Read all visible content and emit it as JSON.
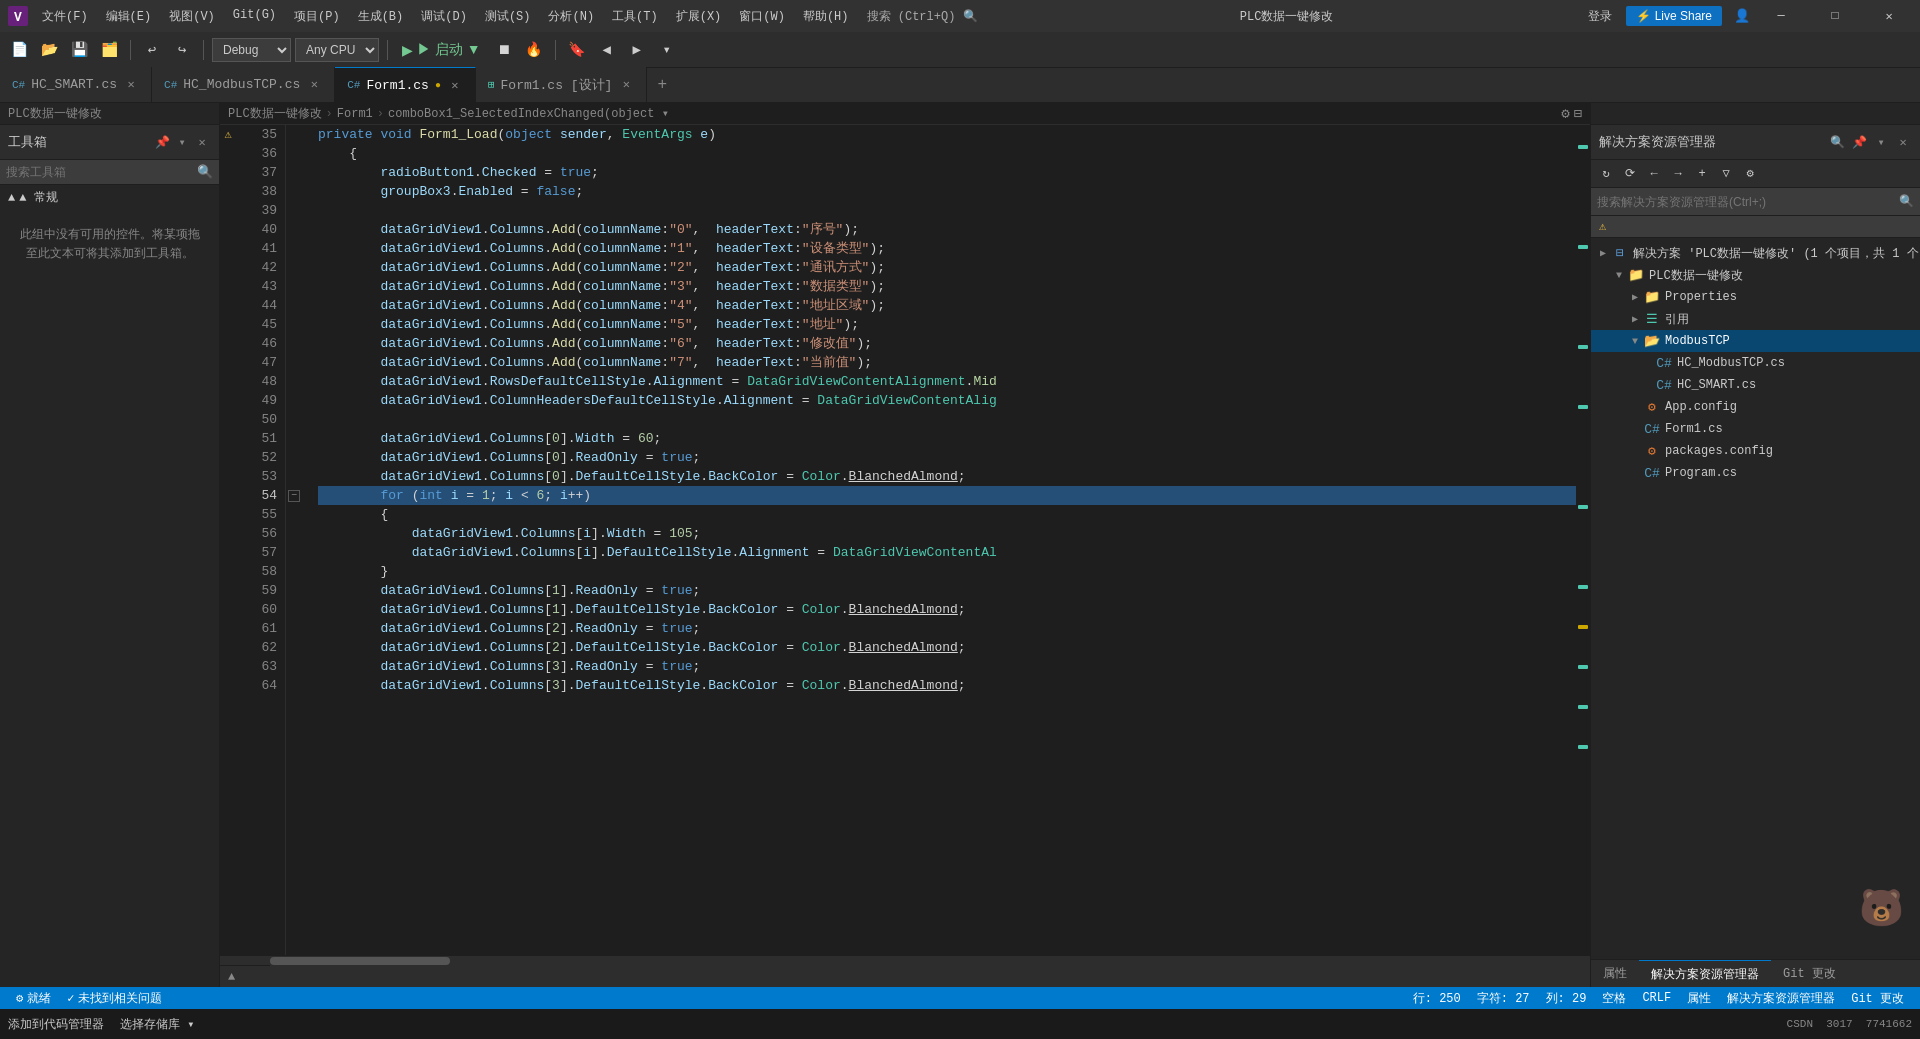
{
  "titleBar": {
    "title": "PLC数据一键修改",
    "menus": [
      "文件(F)",
      "编辑(E)",
      "视图(V)",
      "Git(G)",
      "项目(P)",
      "生成(B)",
      "调试(D)",
      "测试(S)",
      "分析(N)",
      "工具(T)",
      "扩展(X)",
      "窗口(W)",
      "帮助(H)",
      "搜索 (Ctrl+Q)"
    ],
    "loginLabel": "登录",
    "liveshare": "Live Share",
    "winBtns": [
      "—",
      "□",
      "✕"
    ]
  },
  "toolbar": {
    "debugMode": "Debug",
    "platform": "Any CPU",
    "runLabel": "▶ 启动 ▼",
    "buttons": [
      "↩",
      "↪",
      "⬛",
      "▷",
      "⏸",
      "🔥",
      "📁",
      "📋",
      "🔒",
      "📑",
      "◀",
      "▶",
      "▶▶",
      "▶|"
    ]
  },
  "tabs": [
    {
      "label": "HC_SMART.cs",
      "active": false,
      "modified": false
    },
    {
      "label": "HC_ModbusTCP.cs",
      "active": false,
      "modified": false
    },
    {
      "label": "Form1.cs",
      "active": true,
      "modified": true
    },
    {
      "label": "Form1.cs [设计]",
      "active": false,
      "modified": false
    }
  ],
  "breadcrumb": {
    "items": [
      "PLC数据一键修改",
      "Form1",
      "comboBox1_SelectedIndexChanged(object ▾"
    ]
  },
  "toolbox": {
    "title": "工具箱",
    "searchPlaceholder": "搜索工具箱",
    "category": "▲ 常规",
    "emptyText": "此组中没有可用的控件。将某项拖至此文本可将其添加到工具箱。"
  },
  "codeLines": [
    {
      "num": 35,
      "content": "private void Form1_Load(object sender, EventArgs e)",
      "hasCollapse": false
    },
    {
      "num": 36,
      "content": "    {",
      "hasCollapse": false
    },
    {
      "num": 37,
      "content": "        radioButton1.Checked = true;",
      "hasCollapse": false
    },
    {
      "num": 38,
      "content": "        groupBox3.Enabled = false;",
      "hasCollapse": false
    },
    {
      "num": 39,
      "content": "",
      "hasCollapse": false
    },
    {
      "num": 40,
      "content": "        dataGridView1.Columns.Add(columnName:\"0\",  headerText:\"序号\");",
      "hasCollapse": false
    },
    {
      "num": 41,
      "content": "        dataGridView1.Columns.Add(columnName:\"1\",  headerText:\"设备类型\");",
      "hasCollapse": false
    },
    {
      "num": 42,
      "content": "        dataGridView1.Columns.Add(columnName:\"2\",  headerText:\"通讯方式\");",
      "hasCollapse": false
    },
    {
      "num": 43,
      "content": "        dataGridView1.Columns.Add(columnName:\"3\",  headerText:\"数据类型\");",
      "hasCollapse": false
    },
    {
      "num": 44,
      "content": "        dataGridView1.Columns.Add(columnName:\"4\",  headerText:\"地址区域\");",
      "hasCollapse": false
    },
    {
      "num": 45,
      "content": "        dataGridView1.Columns.Add(columnName:\"5\",  headerText:\"地址\");",
      "hasCollapse": false
    },
    {
      "num": 46,
      "content": "        dataGridView1.Columns.Add(columnName:\"6\",  headerText:\"修改值\");",
      "hasCollapse": false
    },
    {
      "num": 47,
      "content": "        dataGridView1.Columns.Add(columnName:\"7\",  headerText:\"当前值\");",
      "hasCollapse": false
    },
    {
      "num": 48,
      "content": "        dataGridView1.RowsDefaultCellStyle.Alignment = DataGridViewContentAlignment.Mid",
      "hasCollapse": false
    },
    {
      "num": 49,
      "content": "        dataGridView1.ColumnHeadersDefaultCellStyle.Alignment = DataGridViewContentAlig",
      "hasCollapse": false
    },
    {
      "num": 50,
      "content": "",
      "hasCollapse": false
    },
    {
      "num": 51,
      "content": "        dataGridView1.Columns[0].Width = 60;",
      "hasCollapse": false
    },
    {
      "num": 52,
      "content": "        dataGridView1.Columns[0].ReadOnly = true;",
      "hasCollapse": false
    },
    {
      "num": 53,
      "content": "        dataGridView1.Columns[0].DefaultCellStyle.BackColor = Color.BlanchedAlmond;",
      "hasCollapse": false
    },
    {
      "num": 54,
      "content": "        for (int i = 1; i < 6; i++)",
      "hasCollapse": true
    },
    {
      "num": 55,
      "content": "        {",
      "hasCollapse": false
    },
    {
      "num": 56,
      "content": "            dataGridView1.Columns[i].Width = 105;",
      "hasCollapse": false
    },
    {
      "num": 57,
      "content": "            dataGridView1.Columns[i].DefaultCellStyle.Alignment = DataGridViewContentAl",
      "hasCollapse": false
    },
    {
      "num": 58,
      "content": "        }",
      "hasCollapse": false
    },
    {
      "num": 59,
      "content": "        dataGridView1.Columns[1].ReadOnly = true;",
      "hasCollapse": false
    },
    {
      "num": 60,
      "content": "        dataGridView1.Columns[1].DefaultCellStyle.BackColor = Color.BlanchedAlmond;",
      "hasCollapse": false
    },
    {
      "num": 61,
      "content": "        dataGridView1.Columns[2].ReadOnly = true;",
      "hasCollapse": false
    },
    {
      "num": 62,
      "content": "        dataGridView1.Columns[2].DefaultCellStyle.BackColor = Color.BlanchedAlmond;",
      "hasCollapse": false
    },
    {
      "num": 63,
      "content": "        dataGridView1.Columns[3].ReadOnly = true;",
      "hasCollapse": false
    },
    {
      "num": 64,
      "content": "        dataGridView1.Columns[3].DefaultCellStyle.BackColor = Color.BlanchedAlmond;",
      "hasCollapse": false
    }
  ],
  "solutionExplorer": {
    "title": "解决方案资源管理器",
    "searchPlaceholder": "搜索解决方案资源管理器(Ctrl+;)",
    "solutionName": "解决方案 'PLC数据一键修改' (1 个项目，共 1 个)",
    "projectName": "PLC数据一键修改",
    "tree": [
      {
        "label": "Properties",
        "type": "folder",
        "indent": 3,
        "expanded": false
      },
      {
        "label": "引用",
        "type": "folder",
        "indent": 3,
        "expanded": false,
        "prefix": "☰"
      },
      {
        "label": "ModbusTCP",
        "type": "folder-open",
        "indent": 2,
        "expanded": true,
        "selected": true
      },
      {
        "label": "HC_ModbusTCP.cs",
        "type": "cs",
        "indent": 4
      },
      {
        "label": "HC_SMART.cs",
        "type": "cs",
        "indent": 4
      },
      {
        "label": "App.config",
        "type": "config",
        "indent": 3
      },
      {
        "label": "Form1.cs",
        "type": "cs",
        "indent": 3
      },
      {
        "label": "packages.config",
        "type": "config",
        "indent": 3
      },
      {
        "label": "Program.cs",
        "type": "cs",
        "indent": 3
      }
    ],
    "bottomTabs": [
      "属性",
      "解决方案资源管理器",
      "Git 更改"
    ]
  },
  "statusBar": {
    "ready": "就绪",
    "noErrors": "✓ 未找到相关问题",
    "line": "行: 250",
    "char": "字符: 27",
    "col": "列: 29",
    "space": "空格",
    "eol": "CRLF",
    "encoding": "属性",
    "branch": "解决方案资源管理器",
    "gitChanges": "Git 更改",
    "addCode": "添加到代码管理器",
    "footer": "选择存储库 ▾",
    "extra": "CSDN  3017  7741662"
  }
}
